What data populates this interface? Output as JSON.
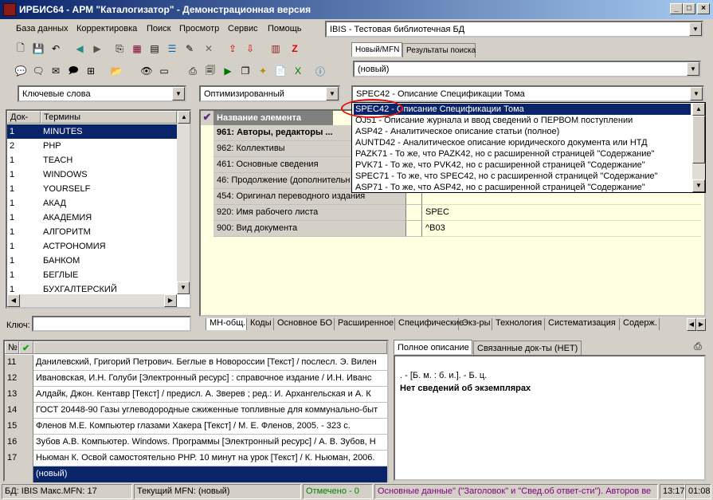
{
  "window": {
    "title": "ИРБИС64 - АРМ \"Каталогизатор\" - Демонстрационная версия"
  },
  "menu": [
    "База данных",
    "Корректировка",
    "Поиск",
    "Просмотр",
    "Сервис",
    "Помощь"
  ],
  "db_combo": "IBIS - Тестовая библиотечная БД",
  "top_tabs": {
    "new": "Новый/MFN",
    "results": "Результаты поиска"
  },
  "new_combo": "(новый)",
  "dict_combo": "Ключевые слова",
  "mode_combo": "Оптимизированный",
  "worksheet_combo": "SPEC42 - Описание Спецификации Тома",
  "worksheet_options": [
    "SPEC42 - Описание Спецификации Тома",
    "OJ51 - Описание журнала и ввод сведений о ПЕРВОМ поступлении",
    "ASP42 - Аналитическое описание статьи (полное)",
    "AUNTD42 - Аналитическое описание юридического документа или НТД",
    "PAZK71 - То же, что PAZK42, но с расширенной страницей \"Содержание\"",
    "PVK71 - То же, что PVK42, но с расширенной страницей \"Содержание\"",
    "SPEC71 - То же, что SPEC42, но с расширенной страницей \"Содержание\"",
    "ASP71 - То же, что ASP42, но с расширенной страницей \"Содержание\""
  ],
  "dict": {
    "col_docs": "Док-ов",
    "col_terms": "Термины",
    "rows": [
      {
        "n": "1",
        "t": "MINUTES"
      },
      {
        "n": "2",
        "t": "PHP"
      },
      {
        "n": "1",
        "t": "TEACH"
      },
      {
        "n": "1",
        "t": "WINDOWS"
      },
      {
        "n": "1",
        "t": "YOURSELF"
      },
      {
        "n": "1",
        "t": "АКАД"
      },
      {
        "n": "1",
        "t": "АКАДЕМИЯ"
      },
      {
        "n": "1",
        "t": "АЛГОРИТМ"
      },
      {
        "n": "1",
        "t": "АСТРОНОМИЯ"
      },
      {
        "n": "1",
        "t": "БАНКОМ"
      },
      {
        "n": "1",
        "t": "БЕГЛЫЕ"
      },
      {
        "n": "1",
        "t": "БУХГАЛТЕРСКИЙ"
      }
    ],
    "key_label": "Ключ:"
  },
  "fields": {
    "header": "Название элемента",
    "rows": [
      {
        "name": "961: Авторы, редакторы ...",
        "value": "",
        "bold": true
      },
      {
        "name": "962: Коллективы",
        "value": ""
      },
      {
        "name": "461: Основные сведения",
        "value": ""
      },
      {
        "name": "46: Продолжение (дополнительн",
        "value": ""
      },
      {
        "name": "454: Оригинал переводного издания",
        "value": ""
      },
      {
        "name": "920: Имя рабочего листа",
        "value": "SPEC"
      },
      {
        "name": "900: Вид документа",
        "value": "^B03"
      }
    ]
  },
  "bottom_tabs": [
    "МН-общ.",
    "Коды",
    "Основное БО",
    "Расширенное",
    "Специфические",
    "Экз-ры",
    "Технология",
    "Систематизация",
    "Содерж."
  ],
  "records": {
    "col_no": "№",
    "rows": [
      {
        "n": "11",
        "t": "Данилевский, Григорий Петрович. Беглые в Новороссии [Текст] / послесл. Э. Вилен"
      },
      {
        "n": "12",
        "t": "Ивановская, И.Н. Голуби [Электронный ресурс] : справочное издание / И.Н. Иванс"
      },
      {
        "n": "13",
        "t": "Алдайк, Джон. Кентавр [Текст] / предисл. А. Зверев ; ред.: И. Архангельская и А. К"
      },
      {
        "n": "14",
        "t": "ГОСТ 20448-90 Газы углеводородные сжиженные топливные для коммунально-быт"
      },
      {
        "n": "15",
        "t": "Фленов М.Е. Компьютер глазами Хакера [Текст] / М. Е. Фленов, 2005. - 323 с."
      },
      {
        "n": "16",
        "t": "Зубов А.В. Компьютер. Windows. Программы [Электронный ресурс] / А. В. Зубов, Н"
      },
      {
        "n": "17",
        "t": "Ньюман К. Освой самостоятельно PHP. 10 минут на урок [Текст] / К. Ньюман, 2006."
      },
      {
        "n": "",
        "t": "(новый)"
      }
    ]
  },
  "preview_tabs": {
    "full": "Полное описание",
    "linked": "Связанные док-ты (НЕТ)"
  },
  "preview": {
    "line1": ". - [Б. м. : б. и.]. - Б. ц.",
    "line2": "Нет сведений об экземплярах"
  },
  "status": {
    "db": "БД: IBIS Макс.MFN: 17",
    "mfn": "Текущий MFN: (новый)",
    "marked": "Отмечено - 0",
    "hint": "Основные данные\" (\"Заголовок\" и \"Свед.об ответ-сти\"). Авторов ве",
    "t1": "13:17",
    "t2": "01:08"
  },
  "colors": {
    "selection": "#0a246a",
    "fields_bg": "#ffffe1",
    "status_green": "#008000",
    "status_purple": "#800080",
    "highlight_ring": "#e01010"
  }
}
